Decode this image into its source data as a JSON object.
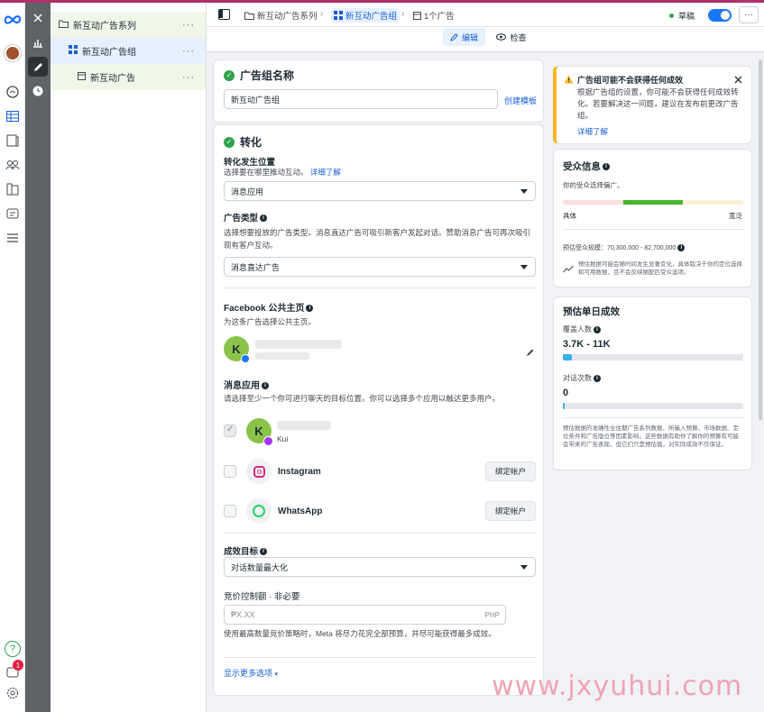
{
  "tree": {
    "campaign": "新互动广告系列",
    "adset": "新互动广告组",
    "ad": "新互动广告"
  },
  "header": {
    "crumb_campaign": "新互动广告系列",
    "crumb_adset": "新互动广告组",
    "crumb_ad": "1个广告",
    "status": "草稿",
    "more": "···",
    "tab_edit": "编辑",
    "tab_review": "检查"
  },
  "adset_name": {
    "title": "广告组名称",
    "value": "新互动广告组",
    "create_template": "创建模板"
  },
  "conversion": {
    "title": "转化",
    "location_label": "转化发生位置",
    "location_sub": "选择要在哪里推动互动。",
    "learn_more": "详细了解",
    "location_value": "消息应用",
    "ad_type_label": "广告类型",
    "ad_type_sub": "选择想要投放的广告类型。消息直达广告可吸引新客户发起对话。赞助消息广告可再次吸引现有客户互动。",
    "ad_type_value": "消息直达广告",
    "fb_page_label": "Facebook 公共主页",
    "fb_page_sub": "为这条广告选择公共主页。",
    "page_avatar_letter": "K",
    "messaging_label": "消息应用",
    "messaging_sub": "请选择至少一个你可进行聊天的目标位置。你可以选择多个应用以触达更多用户。",
    "messenger_short": "Kui",
    "instagram": "Instagram",
    "whatsapp": "WhatsApp",
    "bind_account": "绑定帐户",
    "goal_label": "成效目标",
    "goal_value": "对话数量最大化",
    "bid_label": "竞价控制额 · 非必要",
    "bid_placeholder": "₱X.XX",
    "bid_currency": "PHP",
    "bid_sub": "使用最高数量竞价策略时，Meta 将尽力花完全部预算，并尽可能获得最多成效。",
    "more_options": "显示更多选项"
  },
  "warning": {
    "title": "广告组可能不会获得任何成效",
    "body": "根据广告组的设置，你可能不会获得任何成效转化。若要解决这一问题，建议在发布前更改广告组。",
    "link": "详细了解"
  },
  "audience": {
    "title": "受众信息",
    "sub": "你的受众选择偏广。",
    "left": "具体",
    "right": "宽泛",
    "estimate": "预估受众规模：70,300,000 - 82,700,000",
    "note": "预估数据可能会随时间发生显著变化，具体取决于你的定位选择和可用数据，且不会反映随配匹受众选项。"
  },
  "daily": {
    "title": "预估单日成效",
    "reach_label": "覆盖人数",
    "reach_value": "3.7K - 11K",
    "reach_fill": 0.05,
    "conv_label": "对话次数",
    "conv_value": "0",
    "conv_fill": 0.01,
    "note": "预估数据的准确性全往期广告系列数据、所输入预算、市场数据、定位条件和广告版位等因素影响。这些数据有助你了解你的预算有可能会带来的广告表现，但它们只是预估值，对实际成效不作保证。"
  },
  "watermark": "www.jxyuhui.com",
  "notif_count": "1",
  "colors": {
    "accent": "#1a5fd1",
    "success": "#31a24c",
    "warning": "#f7b928",
    "toggle": "#1877f2"
  }
}
